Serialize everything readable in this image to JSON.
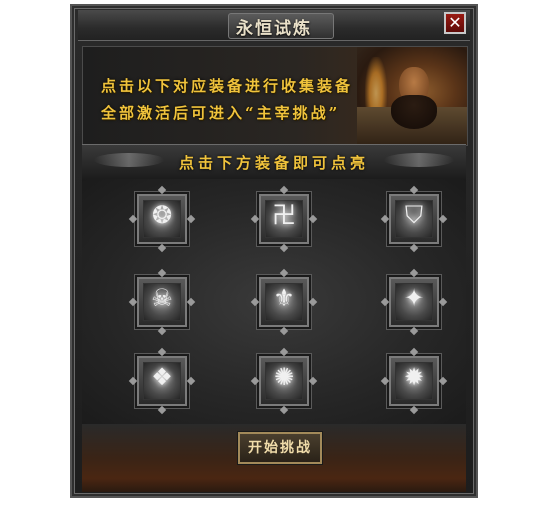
{
  "window": {
    "title": "永恒试炼",
    "close_label": "✕"
  },
  "info": {
    "line1": "点击以下对应装备进行收集装备",
    "line2": "全部激活后可进入“主宰挑战”"
  },
  "ribbon": {
    "text": "点击下方装备即可点亮"
  },
  "slots": [
    {
      "icon": "swirl-emblem-icon",
      "glyph": "❂"
    },
    {
      "icon": "swastika-emblem-icon",
      "glyph": "卍"
    },
    {
      "icon": "shield-emblem-icon",
      "glyph": "⛉"
    },
    {
      "icon": "skull-emblem-icon",
      "glyph": "☠"
    },
    {
      "icon": "crest-emblem-icon",
      "glyph": "⚜"
    },
    {
      "icon": "star-emblem-icon",
      "glyph": "✦"
    },
    {
      "icon": "beast-emblem-icon",
      "glyph": "❖"
    },
    {
      "icon": "wolf-emblem-icon",
      "glyph": "✺"
    },
    {
      "icon": "burst-emblem-icon",
      "glyph": "✹"
    }
  ],
  "footer": {
    "start_label": "开始挑战"
  },
  "colors": {
    "gold_text": "#f0c33c",
    "close_red": "#9a1a12"
  }
}
